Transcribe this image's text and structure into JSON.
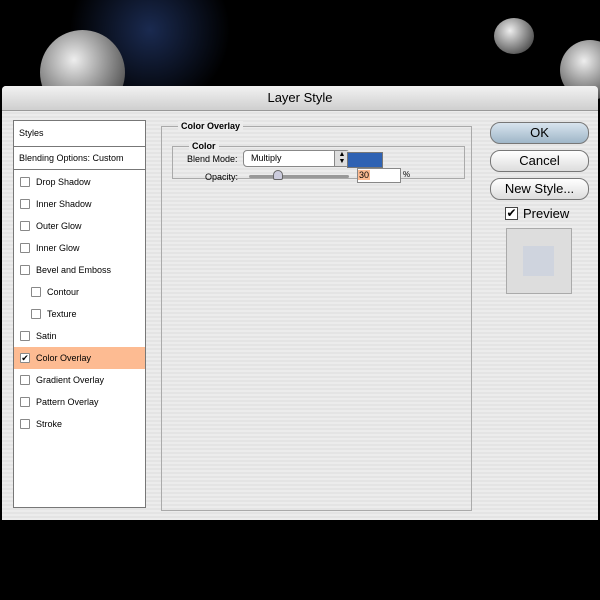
{
  "window": {
    "title": "Layer Style"
  },
  "styles_list": {
    "header": "Styles",
    "blending": "Blending Options: Custom",
    "items": [
      {
        "label": "Drop Shadow",
        "checked": false
      },
      {
        "label": "Inner Shadow",
        "checked": false
      },
      {
        "label": "Outer Glow",
        "checked": false
      },
      {
        "label": "Inner Glow",
        "checked": false
      },
      {
        "label": "Bevel and Emboss",
        "checked": false
      },
      {
        "label": "Contour",
        "checked": false,
        "sub": true
      },
      {
        "label": "Texture",
        "checked": false,
        "sub": true
      },
      {
        "label": "Satin",
        "checked": false
      },
      {
        "label": "Color Overlay",
        "checked": true,
        "selected": true
      },
      {
        "label": "Gradient Overlay",
        "checked": false
      },
      {
        "label": "Pattern Overlay",
        "checked": false
      },
      {
        "label": "Stroke",
        "checked": false
      }
    ]
  },
  "panel": {
    "title": "Color Overlay",
    "group": "Color",
    "blend_label": "Blend Mode:",
    "blend_value": "Multiply",
    "overlay_color": "#2f62b3",
    "opacity_label": "Opacity:",
    "opacity_value": "30",
    "opacity_unit": "%"
  },
  "buttons": {
    "ok": "OK",
    "cancel": "Cancel",
    "new_style": "New Style...",
    "preview": "Preview",
    "preview_checked": true
  }
}
